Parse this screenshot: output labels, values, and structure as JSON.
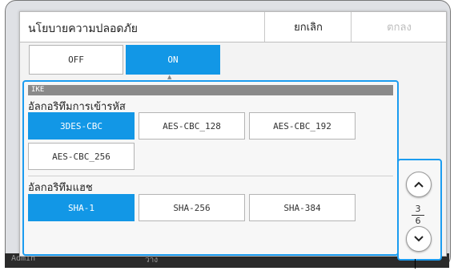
{
  "dialog": {
    "title": "นโยบายความปลอดภัย",
    "cancel_label": "ยกเลิก",
    "ok_label": "ตกลง"
  },
  "toggle": {
    "off_label": "OFF",
    "on_label": "ON",
    "selected": "ON"
  },
  "ike": {
    "section_label": "IKE",
    "encryption": {
      "label": "อัลกอริทึมการเข้ารหัส",
      "options": [
        "3DES-CBC",
        "AES-CBC_128",
        "AES-CBC_192",
        "AES-CBC_256"
      ],
      "selected": "3DES-CBC"
    },
    "hash": {
      "label": "อัลกอริทึมแฮช",
      "options": [
        "SHA-1",
        "SHA-256",
        "SHA-384"
      ],
      "selected": "SHA-1"
    }
  },
  "pager": {
    "current": "3",
    "total": "6"
  },
  "background": {
    "user_label": "Admin",
    "status_label": "ว่าง"
  },
  "colors": {
    "accent": "#1297e6",
    "focus_border": "#1b9cf0",
    "section_bar": "#8a8a8a"
  }
}
